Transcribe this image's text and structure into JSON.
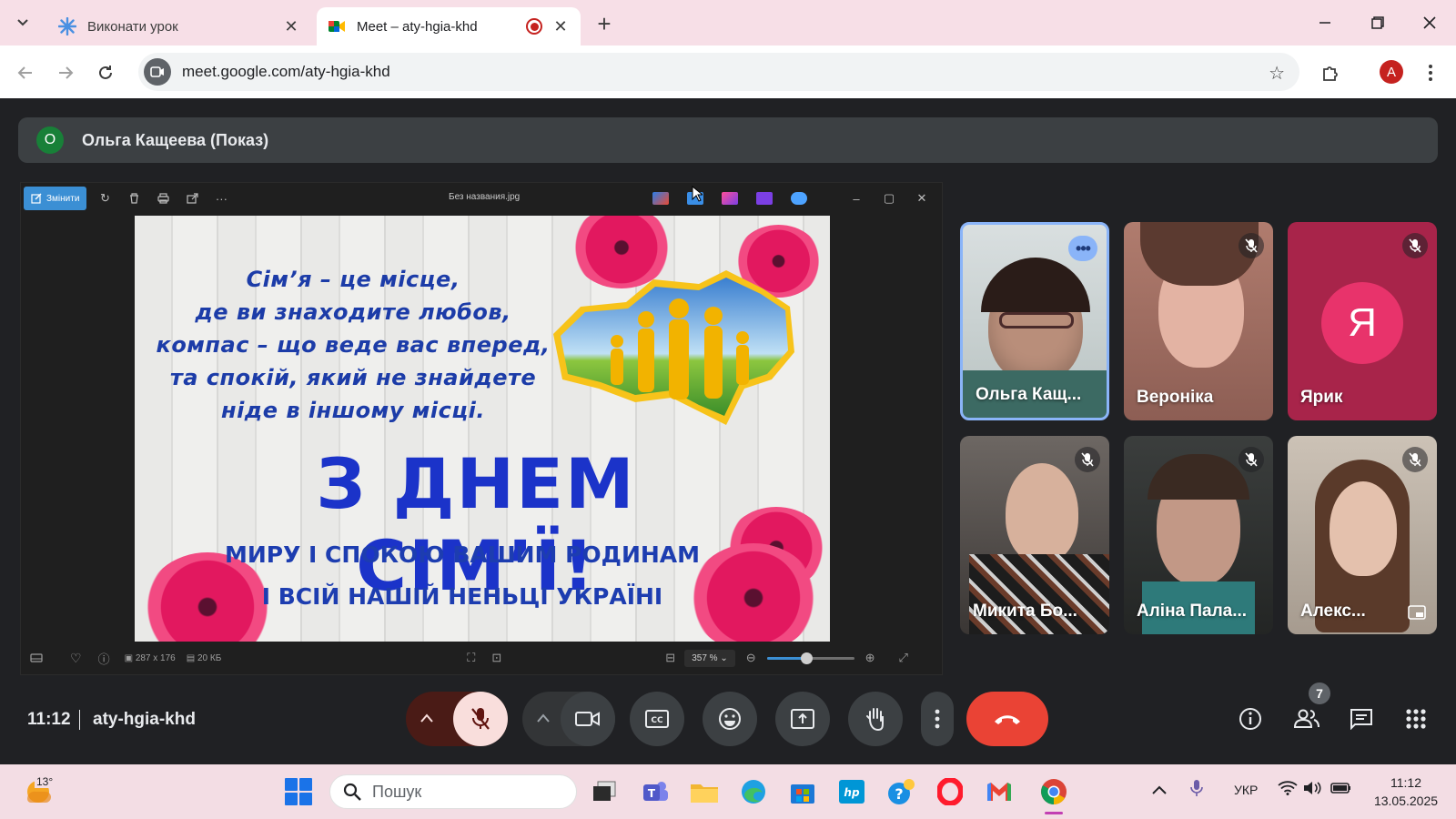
{
  "browser": {
    "tabs": [
      {
        "title": "Виконати урок",
        "active": false
      },
      {
        "title": "Meet – aty-hgia-khd",
        "active": true,
        "recording": true
      }
    ],
    "url": "meet.google.com/aty-hgia-khd",
    "profile_initial": "A"
  },
  "meet": {
    "presenter": {
      "initial": "О",
      "label": "Ольга Кащеева (Показ)"
    },
    "viewer": {
      "edit_label": "Змінити",
      "filename": "Без названия.jpg",
      "dimensions": "287 x 176",
      "filesize": "20 КБ",
      "zoom": "357 %",
      "zoom_level": 0.45
    },
    "card": {
      "quote": [
        "Сім’я – це місце,",
        "де ви знаходите любов,",
        "компас – що веде вас вперед,",
        "та спокій, який не знайдете",
        "ніде в іншому місці."
      ],
      "headline": "З ДНЕМ СІМ’Ї!",
      "wish": [
        "МИРУ І СПОКОЮ ВАШИМ РОДИНАМ",
        "І ВСІЙ НАШІЙ НЕНЬЦІ УКРАЇНІ"
      ]
    },
    "participants": [
      {
        "name": "Ольга Кащ...",
        "muted": false,
        "active": true
      },
      {
        "name": "Вероніка",
        "muted": true
      },
      {
        "name": "Ярик",
        "muted": true,
        "avatar_letter": "Я",
        "avatar_color": "#e8336b"
      },
      {
        "name": "Микита Бо...",
        "muted": true
      },
      {
        "name": "Аліна Пала...",
        "muted": true
      },
      {
        "name": "Алекс...",
        "muted": true
      }
    ],
    "time": "11:12",
    "meeting_code": "aty-hgia-khd",
    "participant_count": "7"
  },
  "taskbar": {
    "temperature": "13°",
    "search_placeholder": "Пошук",
    "language": "УКР",
    "time": "11:12",
    "date": "13.05.2025"
  }
}
